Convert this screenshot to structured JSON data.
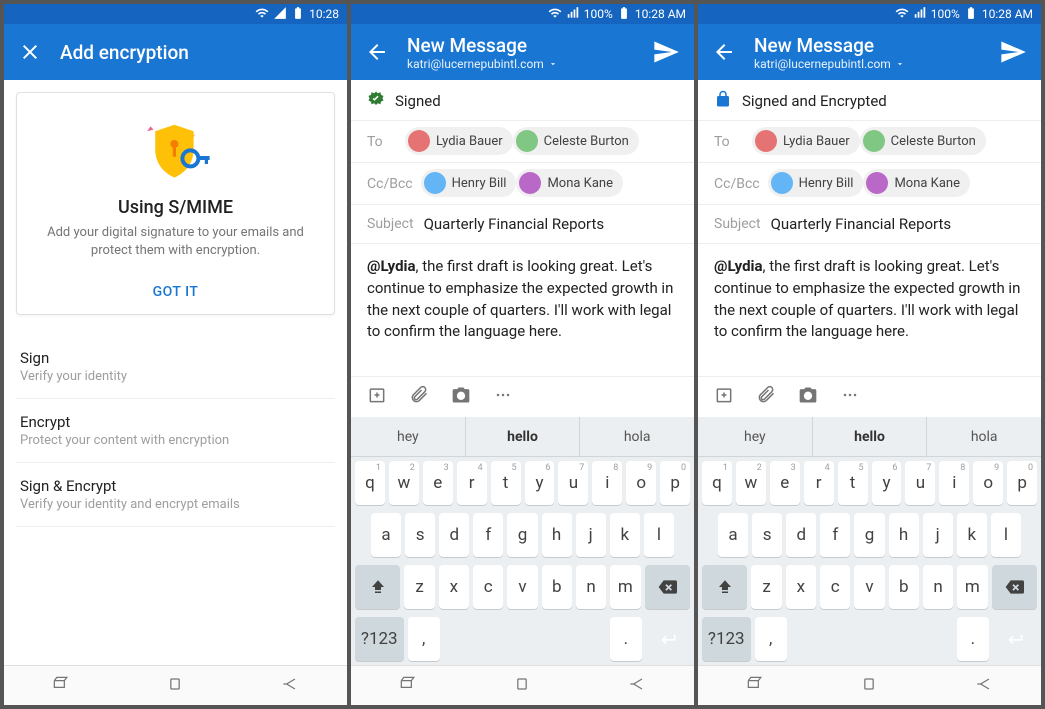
{
  "statusbar1": {
    "time": "10:28"
  },
  "statusbar2": {
    "signal": "100%",
    "time": "10:28 AM"
  },
  "screen1": {
    "title": "Add encryption",
    "card": {
      "title": "Using S/MIME",
      "desc": "Add your digital signature to your emails and protect them with encryption.",
      "action": "GOT IT"
    },
    "options": [
      {
        "title": "Sign",
        "desc": "Verify your identity"
      },
      {
        "title": "Encrypt",
        "desc": "Protect your content with encryption"
      },
      {
        "title": "Sign & Encrypt",
        "desc": "Verify your identity and encrypt emails"
      }
    ]
  },
  "compose": {
    "title": "New Message",
    "account": "katri@lucernepubintl.com",
    "status_signed": "Signed",
    "status_encrypted": "Signed and Encrypted",
    "to_label": "To",
    "cc_label": "Cc/Bcc",
    "subject_label": "Subject",
    "subject": "Quarterly Financial Reports",
    "to": [
      "Lydia Bauer",
      "Celeste Burton"
    ],
    "cc": [
      "Henry Bill",
      "Mona Kane"
    ],
    "mention": "@Lydia",
    "body_rest": ", the first draft is looking great. Let's continue to emphasize the expected growth in the next couple of quarters. I'll work with legal to confirm the language here."
  },
  "keyboard": {
    "suggestions": [
      "hey",
      "hello",
      "hola"
    ],
    "row1": [
      {
        "k": "q",
        "n": "1"
      },
      {
        "k": "w",
        "n": "2"
      },
      {
        "k": "e",
        "n": "3"
      },
      {
        "k": "r",
        "n": "4"
      },
      {
        "k": "t",
        "n": "5"
      },
      {
        "k": "y",
        "n": "6"
      },
      {
        "k": "u",
        "n": "7"
      },
      {
        "k": "i",
        "n": "8"
      },
      {
        "k": "o",
        "n": "9"
      },
      {
        "k": "p",
        "n": "0"
      }
    ],
    "row2": [
      "a",
      "s",
      "d",
      "f",
      "g",
      "h",
      "j",
      "k",
      "l"
    ],
    "row3": [
      "z",
      "x",
      "c",
      "v",
      "b",
      "n",
      "m"
    ],
    "symkey": "?123",
    "comma": ",",
    "period": "."
  },
  "avatar_colors": [
    "#e57373",
    "#81c784",
    "#64b5f6",
    "#ba68c8"
  ]
}
